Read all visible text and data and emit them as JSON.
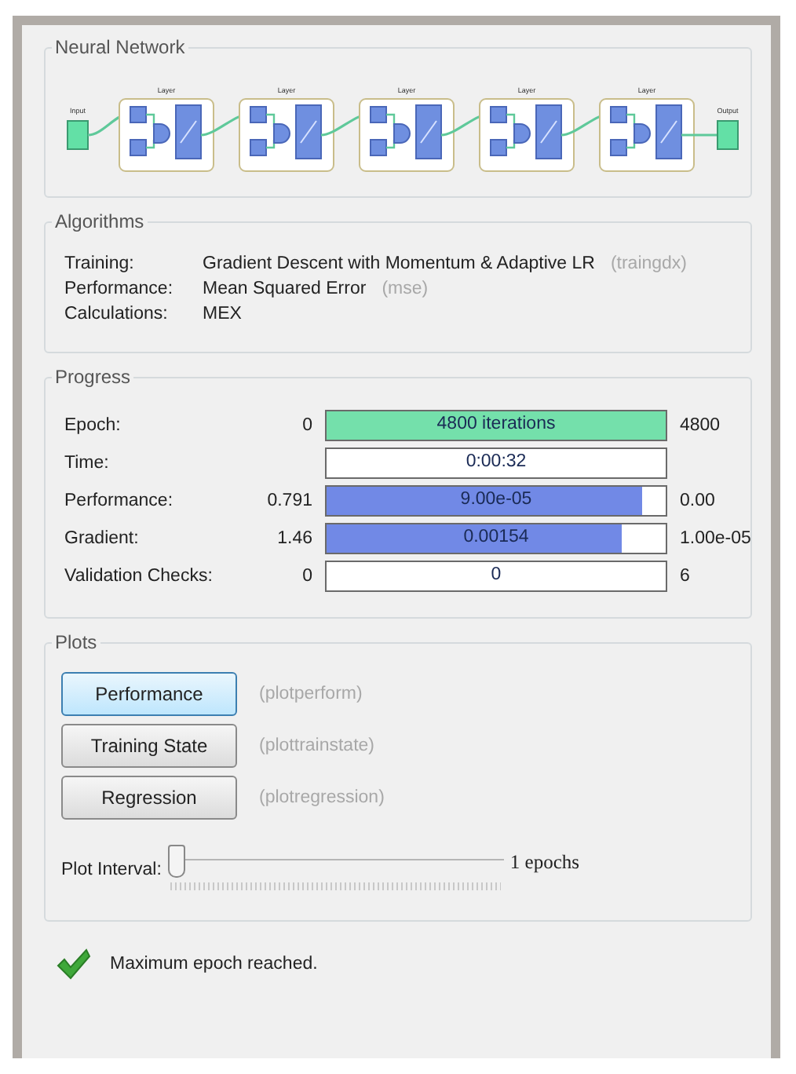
{
  "network": {
    "title": "Neural Network",
    "input_label": "Input",
    "output_label": "Output",
    "layers": [
      {
        "label": "Layer"
      },
      {
        "label": "Layer"
      },
      {
        "label": "Layer"
      },
      {
        "label": "Layer"
      },
      {
        "label": "Layer"
      }
    ]
  },
  "algorithms": {
    "title": "Algorithms",
    "rows": [
      {
        "label": "Training:",
        "value": "Gradient Descent with Momentum & Adaptive LR",
        "code": "(traingdx)"
      },
      {
        "label": "Performance:",
        "value": "Mean Squared Error",
        "code": "(mse)"
      },
      {
        "label": "Calculations:",
        "value": "MEX"
      }
    ]
  },
  "progress": {
    "title": "Progress",
    "rows": [
      {
        "kind": "epoch",
        "label": "Epoch:",
        "start": "0",
        "level": 1,
        "reading": "4800 iterations",
        "end": "4800"
      },
      {
        "kind": "measure",
        "label": "Time:",
        "level": 0,
        "reading": "0:00:32"
      },
      {
        "kind": "measure",
        "label": "Performance:",
        "start": "0.791",
        "level": 0.93,
        "reading": "9.00e-05",
        "end": "0.00"
      },
      {
        "kind": "measure",
        "label": "Gradient:",
        "start": "1.46",
        "level": 0.87,
        "reading": "0.00154",
        "end": "1.00e-05"
      },
      {
        "kind": "measure",
        "label": "Validation Checks:",
        "start": "0",
        "level": 0,
        "reading": "0",
        "end": "6"
      }
    ]
  },
  "plots": {
    "title": "Plots",
    "buttons": [
      {
        "label": "Performance",
        "function": "(plotperform)",
        "focused": true
      },
      {
        "label": "Training State",
        "function": "(plottrainstate)",
        "focused": false
      },
      {
        "label": "Regression",
        "function": "(plotregression)",
        "focused": false
      }
    ],
    "interval": {
      "label": "Plot Interval:",
      "level": 0,
      "reading": "1 epochs"
    }
  },
  "status": {
    "kind": "success",
    "text": "Maximum epoch reached."
  }
}
